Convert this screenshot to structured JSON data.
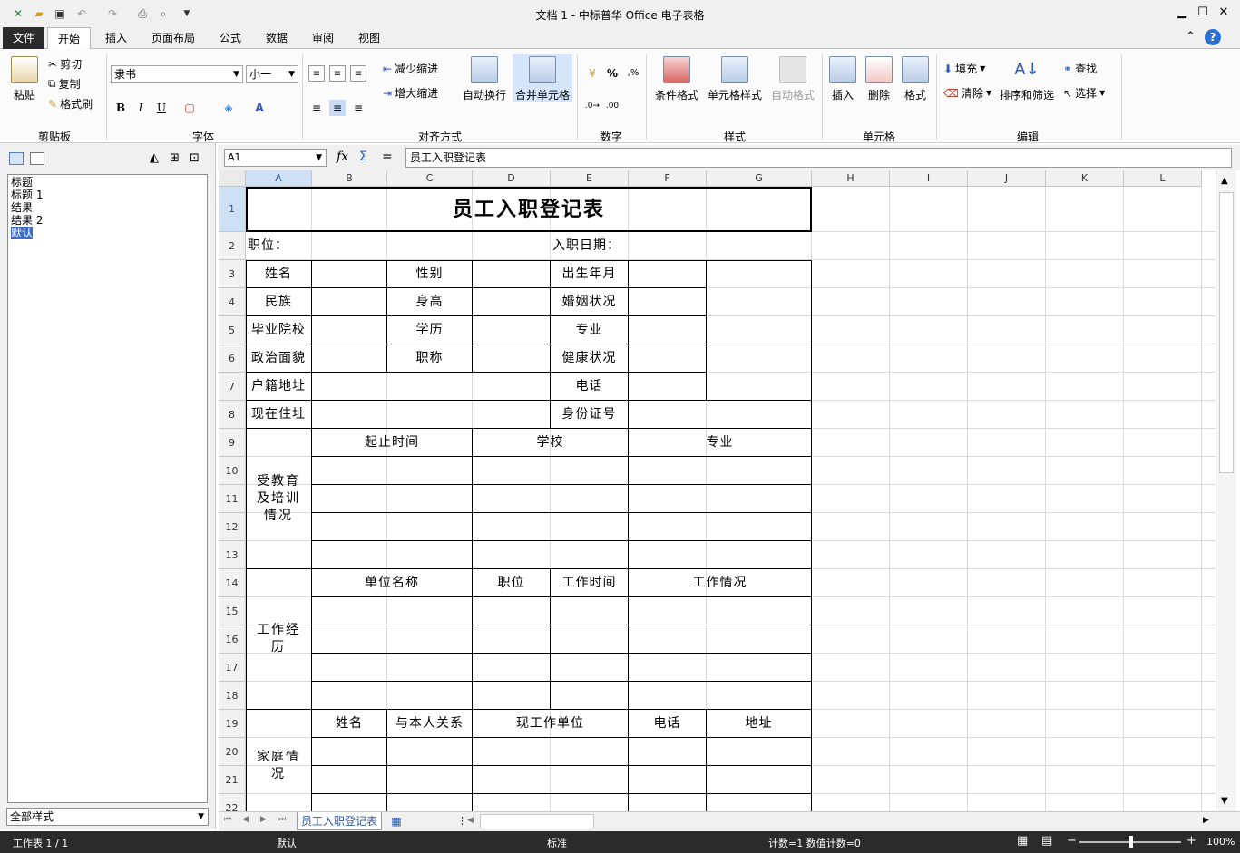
{
  "window": {
    "title": "文档 1 - 中标普华 Office 电子表格"
  },
  "menu": {
    "file": "文件",
    "tabs": [
      "开始",
      "插入",
      "页面布局",
      "公式",
      "数据",
      "审阅",
      "视图"
    ],
    "active": "开始"
  },
  "ribbon": {
    "clipboard": {
      "paste": "粘贴",
      "cut": "剪切",
      "copy": "复制",
      "format_painter": "格式刷",
      "label": "剪贴板"
    },
    "font": {
      "name": "隶书",
      "size": "小一",
      "bold": "B",
      "italic": "I",
      "underline": "U",
      "label": "字体"
    },
    "align": {
      "decrease_indent": "减少缩进",
      "increase_indent": "增大缩进",
      "wrap": "自动换行",
      "merge": "合并单元格",
      "label": "对齐方式"
    },
    "number": {
      "percent": "%",
      "label": "数字"
    },
    "styles": {
      "conditional": "条件格式",
      "cell_style": "单元格样式",
      "auto_format": "自动格式",
      "label": "样式"
    },
    "cells": {
      "insert": "插入",
      "delete": "删除",
      "format": "格式",
      "label": "单元格"
    },
    "editing": {
      "fill": "填充",
      "clear": "清除",
      "sort_filter": "排序和筛选",
      "find": "查找",
      "select": "选择",
      "label": "编辑"
    }
  },
  "styles_pane": {
    "items": [
      "标题",
      "标题 1",
      "结果",
      "结果 2",
      "默认"
    ],
    "selected": "默认",
    "filter": "全部样式"
  },
  "formula_bar": {
    "namebox": "A1",
    "content": "员工入职登记表"
  },
  "columns": [
    "A",
    "B",
    "C",
    "D",
    "E",
    "F",
    "G",
    "H",
    "I",
    "J",
    "K",
    "L"
  ],
  "rows": [
    "1",
    "2",
    "3",
    "4",
    "5",
    "6",
    "7",
    "8",
    "9",
    "10",
    "11",
    "12",
    "13",
    "14",
    "15",
    "16",
    "17",
    "18",
    "19",
    "20",
    "21",
    "22"
  ],
  "sheet": {
    "title": "员工入职登记表",
    "position": "职位：",
    "entry_date": "入职日期：",
    "name": "姓名",
    "gender": "性别",
    "birth": "出生年月",
    "ethnicity": "民族",
    "height": "身高",
    "marital": "婚姻状况",
    "school_grad": "毕业院校",
    "education": "学历",
    "major": "专业",
    "political": "政治面貌",
    "job_title": "职称",
    "health": "健康状况",
    "hukou": "户籍地址",
    "phone": "电话",
    "address": "现在住址",
    "id_no": "身份证号",
    "edu_section": "受教育及培训情况",
    "period": "起止时间",
    "school": "学校",
    "edu_major": "专业",
    "work_section": "工作经历",
    "company": "单位名称",
    "w_position": "职位",
    "work_time": "工作时间",
    "work_status": "工作情况",
    "family_section": "家庭情况",
    "f_name": "姓名",
    "relation": "与本人关系",
    "f_company": "现工作单位",
    "f_phone": "电话",
    "f_address": "地址"
  },
  "sheet_tabs": [
    "员工入职登记表"
  ],
  "status": {
    "sheet": "工作表 1 / 1",
    "style": "默认",
    "mode": "标准",
    "count": "计数=1  数值计数=0",
    "zoom": "100%"
  }
}
